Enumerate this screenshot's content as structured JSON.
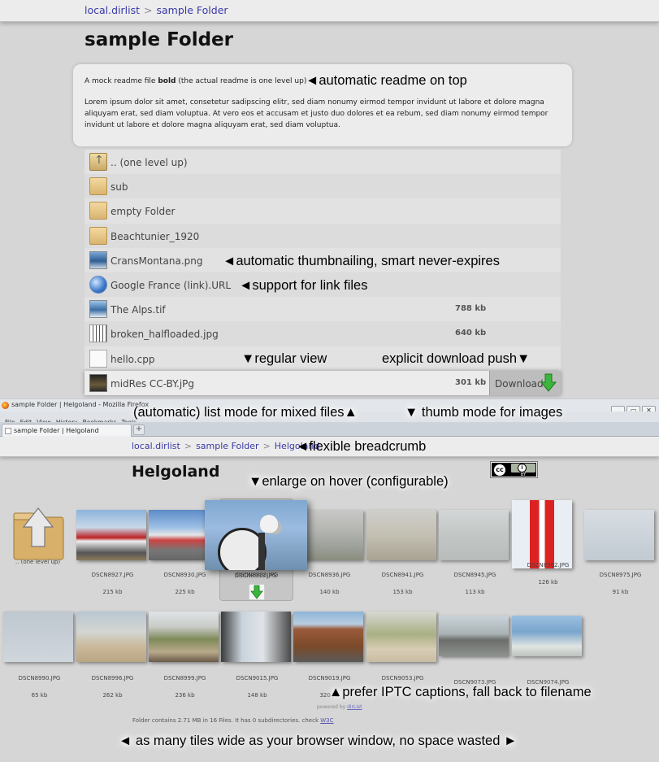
{
  "top": {
    "breadcrumb": {
      "root": "local.dirlist",
      "sep": ">",
      "current": "sample Folder"
    },
    "title": "sample Folder",
    "readme": {
      "line1_pre": "A mock readme file ",
      "line1_bold": "bold",
      "line1_post": " (the actual readme is one level up)",
      "body": "Lorem ipsum dolor sit amet, consetetur sadipscing elitr, sed diam nonumy eirmod tempor invidunt ut labore et dolore magna aliquyam erat, sed diam voluptua. At vero eos et accusam et justo duo dolores et ea rebum, sed diam nonumy eirmod tempor invidunt ut labore et dolore magna aliquyam erat, sed diam voluptua."
    },
    "rows": [
      {
        "name": ".. (one level up)",
        "size": "",
        "icon": "up-folder-icon"
      },
      {
        "name": "sub",
        "size": "",
        "icon": "folder-icon"
      },
      {
        "name": "empty Folder",
        "size": "",
        "icon": "folder-icon"
      },
      {
        "name": "Beachtunier_1920",
        "size": "",
        "icon": "folder-icon"
      },
      {
        "name": "CransMontana.png",
        "size": "",
        "icon": "image-thumbnail-icon"
      },
      {
        "name": "Google France (link).URL",
        "size": "",
        "icon": "globe-link-icon"
      },
      {
        "name": "The Alps.tif",
        "size": "788 kb",
        "icon": "image-thumbnail-icon"
      },
      {
        "name": "broken_halfloaded.jpg",
        "size": "640 kb",
        "icon": "broken-image-icon"
      },
      {
        "name": "hello.cpp",
        "size": "",
        "icon": "document-icon"
      },
      {
        "name": "midRes CC-BY.jPg",
        "size": "301 kb",
        "icon": "image-thumbnail-icon"
      }
    ],
    "download_label": "Download"
  },
  "annotations": {
    "readme": "◄automatic readme on top",
    "thumbnailing": "◄automatic thumbnailing, smart never-expires",
    "linkfiles": "◄support for link files",
    "regular": "▼regular view",
    "push": "explicit download push▼",
    "listmode": "(automatic) list mode for mixed files▲",
    "thumbmode": "▼ thumb mode for images",
    "breadcrumb": "◄flexible breadcrumb",
    "hover": "▼enlarge on hover (configurable)",
    "iptc": "▲prefer IPTC captions, fall back to filename",
    "tiles": "◄ as many tiles wide as your browser window, no space wasted ►"
  },
  "firefox": {
    "window_title": "sample Folder | Helgoland - Mozilla Firefox",
    "menu": [
      "File",
      "Edit",
      "View",
      "History",
      "Bookmarks",
      "Tools"
    ],
    "tab": "sample Folder | Helgoland",
    "new_tab": "+",
    "win_buttons": [
      "_",
      "▭",
      "✕"
    ]
  },
  "bottom": {
    "breadcrumb": {
      "root": "local.dirlist",
      "mid": "sample Folder",
      "current": "Helgoland",
      "sep": ">"
    },
    "title": "Helgoland",
    "license": {
      "cc": "cc",
      "by_symbol": "i",
      "by": "BY"
    },
    "tiles_row1": [
      {
        "name": ".. (one level up)",
        "size": ""
      },
      {
        "name": "DSCN8927.JPG",
        "size": "215 kb"
      },
      {
        "name": "DSCN8930.JPG",
        "size": "225 kb"
      },
      {
        "name": "DSCN8933.JPG",
        "size": ""
      },
      {
        "name": "DSCN8936.JPG",
        "size": "140 kb"
      },
      {
        "name": "DSCN8941.JPG",
        "size": "153 kb"
      },
      {
        "name": "DSCN8945.JPG",
        "size": "113 kb"
      },
      {
        "name": "DSCN8962.JPG",
        "size": "126 kb"
      },
      {
        "name": "DSCN8975.JPG",
        "size": "91 kb"
      }
    ],
    "tiles_row2": [
      {
        "name": "DSCN8990.JPG",
        "size": "65 kb"
      },
      {
        "name": "DSCN8996.JPG",
        "size": "262 kb"
      },
      {
        "name": "DSCN8999.JPG",
        "size": "236 kb"
      },
      {
        "name": "DSCN9015.JPG",
        "size": "148 kb"
      },
      {
        "name": "DSCN9019.JPG",
        "size": "320 kb"
      },
      {
        "name": "DSCN9053.JPG",
        "size": ""
      },
      {
        "name": "DSCN9073.JPG",
        "size": ""
      },
      {
        "name": "DSCN9074.JPG",
        "size": ""
      }
    ],
    "powered_pre": "powered by ",
    "powered_link": "dirList",
    "footer_text": "Folder contains 2.71 MB in 16 Files. It has 0 subdirectories. check ",
    "footer_link": "W3C"
  },
  "colors": {
    "link": "#3a3aa8",
    "download_arrow": "#3cb53c",
    "background": "#d6d6d6"
  }
}
